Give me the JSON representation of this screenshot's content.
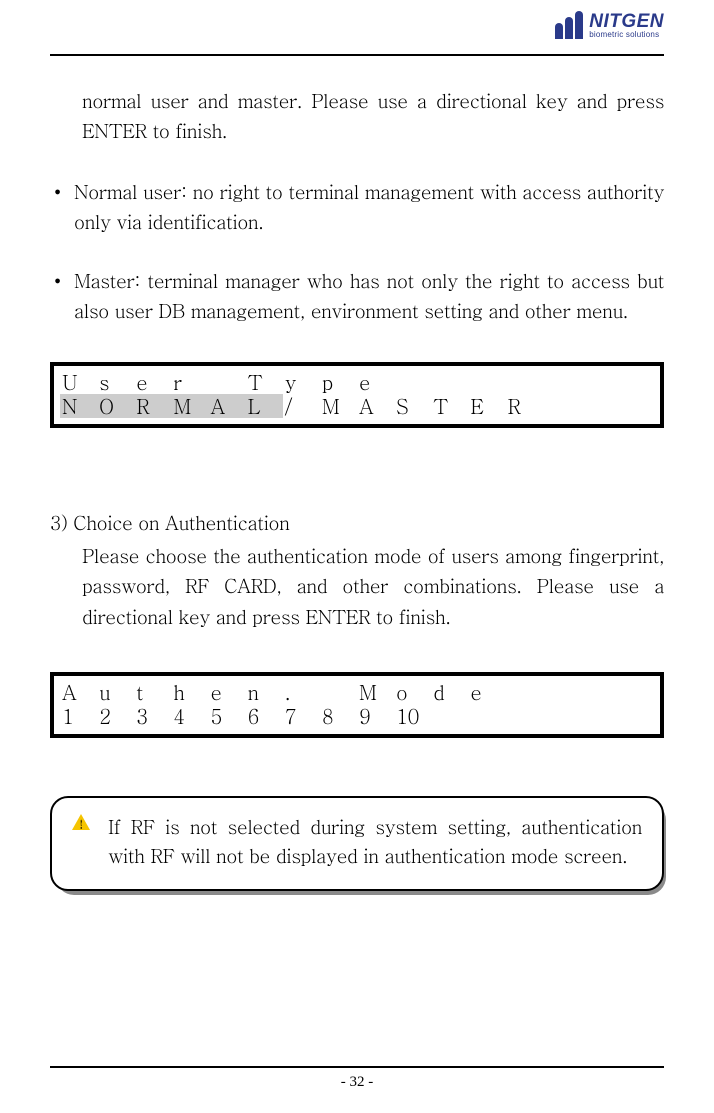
{
  "brand": {
    "name": "NITGEN",
    "tagline": "biometric solutions"
  },
  "intro": "normal user and master. Please use a directional key and press ENTER to finish.",
  "bullets": [
    "Normal user: no right to terminal management with access authority only via identification.",
    "Master: terminal manager who has not only the right to access but also user DB management, environment setting and other menu."
  ],
  "lcd1": {
    "row1": [
      "U",
      "s",
      "e",
      "r",
      "",
      "T",
      "y",
      "p",
      "e",
      "",
      "",
      "",
      "",
      "",
      "",
      ""
    ],
    "row2": [
      "N",
      "O",
      "R",
      "M",
      "A",
      "L",
      "/",
      "M",
      "A",
      "S",
      "T",
      "E",
      "R",
      "",
      "",
      ""
    ],
    "highlight_count": 6
  },
  "section3": {
    "title": "3) Choice on Authentication",
    "body": "Please choose the authentication mode of users among fingerprint, password, RF CARD, and other combinations. Please use a directional key and press ENTER to finish."
  },
  "lcd2": {
    "row1": [
      "A",
      "u",
      "t",
      "h",
      "e",
      "n",
      ".",
      "",
      "M",
      "o",
      "d",
      "e",
      "",
      "",
      "",
      ""
    ],
    "row2": [
      "1",
      "2",
      "3",
      "4",
      "5",
      "6",
      "7",
      "8",
      "9",
      "10",
      "",
      "",
      "",
      "",
      "",
      ""
    ]
  },
  "notice": "If RF is not selected during system setting, authentication with RF will not be displayed in authentication mode screen.",
  "page_number": "- 32 -"
}
